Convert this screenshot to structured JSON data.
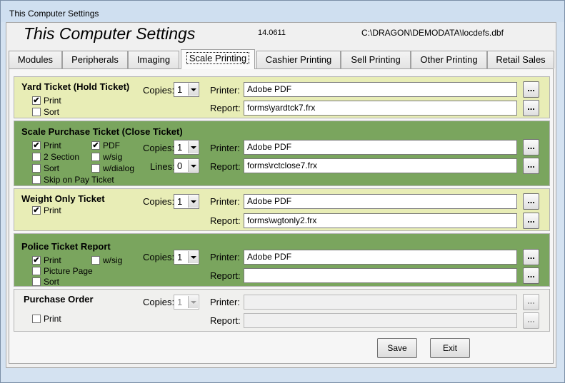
{
  "window": {
    "title": "This Computer Settings"
  },
  "header": {
    "app_title": "This Computer Settings",
    "version": "14.0611",
    "data_path": "C:\\DRAGON\\DEMODATA\\locdefs.dbf"
  },
  "tabs": [
    {
      "label": "Modules"
    },
    {
      "label": "Peripherals"
    },
    {
      "label": "Imaging"
    },
    {
      "label": "Scale Printing",
      "active": true
    },
    {
      "label": "Cashier Printing"
    },
    {
      "label": "Sell Printing"
    },
    {
      "label": "Other Printing"
    },
    {
      "label": "Retail Sales"
    }
  ],
  "labels": {
    "copies": "Copies:",
    "lines": "Lines:",
    "printer": "Printer:",
    "report": "Report:",
    "ellipsis": "..."
  },
  "sections": {
    "yard": {
      "title": "Yard Ticket (Hold Ticket)",
      "print": {
        "label": "Print",
        "checked": true
      },
      "sort": {
        "label": "Sort",
        "checked": false
      },
      "copies": "1",
      "printer": "Adobe PDF",
      "report": "forms\\yardtck7.frx"
    },
    "purchase": {
      "title": "Scale Purchase Ticket (Close Ticket)",
      "print": {
        "label": "Print",
        "checked": true
      },
      "pdf": {
        "label": "PDF",
        "checked": true
      },
      "two_section": {
        "label": "2 Section",
        "checked": false
      },
      "wsig": {
        "label": "w/sig",
        "checked": false
      },
      "sort": {
        "label": "Sort",
        "checked": false
      },
      "wdialog": {
        "label": "w/dialog",
        "checked": false
      },
      "skip_on_pay": {
        "label": "Skip on Pay Ticket",
        "checked": false
      },
      "copies": "1",
      "lines": "0",
      "printer": "Adobe PDF",
      "report": "forms\\rctclose7.frx"
    },
    "weight": {
      "title": "Weight Only Ticket",
      "print": {
        "label": "Print",
        "checked": true
      },
      "copies": "1",
      "printer": "Adobe PDF",
      "report": "forms\\wgtonly2.frx"
    },
    "police": {
      "title": "Police Ticket Report",
      "print": {
        "label": "Print",
        "checked": true
      },
      "wsig": {
        "label": "w/sig",
        "checked": false
      },
      "picture_page": {
        "label": "Picture Page",
        "checked": false
      },
      "sort": {
        "label": "Sort",
        "checked": false
      },
      "copies": "1",
      "printer": "Adobe PDF",
      "report": ""
    },
    "order": {
      "title": "Purchase Order",
      "print": {
        "label": "Print",
        "checked": false
      },
      "copies": "1",
      "printer": "",
      "report": ""
    }
  },
  "buttons": {
    "save": "Save",
    "exit": "Exit"
  }
}
